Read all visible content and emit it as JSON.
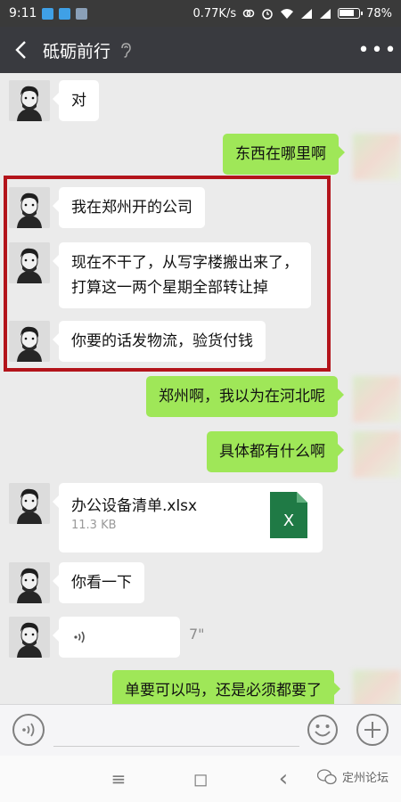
{
  "status_bar": {
    "time": "9:11",
    "network_speed": "0.77K/s",
    "battery_percent": "78%",
    "battery_level": 0.78,
    "icons": [
      "notification-icon-1",
      "notification-icon-2",
      "notification-icon-3",
      "link-icon",
      "alarm-icon",
      "wifi-icon",
      "signal-icon",
      "signal-icon",
      "battery-icon"
    ]
  },
  "nav": {
    "back_icon": "back-chevron-icon",
    "title": "砥砺前行",
    "earpiece_icon": "earpiece-mode-icon",
    "more_label": "•••"
  },
  "messages": [
    {
      "side": "in",
      "text": "对"
    },
    {
      "side": "out",
      "text": "东西在哪里啊"
    },
    {
      "side": "in",
      "text": "我在郑州开的公司"
    },
    {
      "side": "in",
      "line1": "现在不干了，从写字楼搬出来了，",
      "line2": "打算这一两个星期全部转让掉"
    },
    {
      "side": "in",
      "text": "你要的话发物流，验货付钱"
    },
    {
      "side": "out",
      "text": "郑州啊，我以为在河北呢"
    },
    {
      "side": "out",
      "text": "具体都有什么啊"
    },
    {
      "side": "in",
      "type": "file",
      "file_name": "办公设备清单.xlsx",
      "file_size": "11.3 KB",
      "file_icon": "excel-file-icon",
      "file_icon_letter": "X"
    },
    {
      "side": "in",
      "text": "你看一下"
    },
    {
      "side": "in",
      "type": "voice",
      "duration": "7\"",
      "voice_icon": "voice-wave-icon"
    },
    {
      "side": "out",
      "text": "单要可以吗，还是必须都要了"
    }
  ],
  "input_bar": {
    "voice_toggle_icon": "voice-input-icon",
    "text_value": "",
    "emoji_icon": "emoji-icon",
    "plus_icon": "plus-icon"
  },
  "system_nav": {
    "menu_glyph": "≡",
    "home_glyph": "◻",
    "back_glyph": "‹"
  },
  "watermark": {
    "text": "定州论坛"
  },
  "colors": {
    "out_bubble": "#9fe758",
    "in_bubble": "#ffffff",
    "nav_bg": "#393a3f",
    "highlight_border": "#b3141b",
    "chat_bg": "#ebebeb"
  }
}
